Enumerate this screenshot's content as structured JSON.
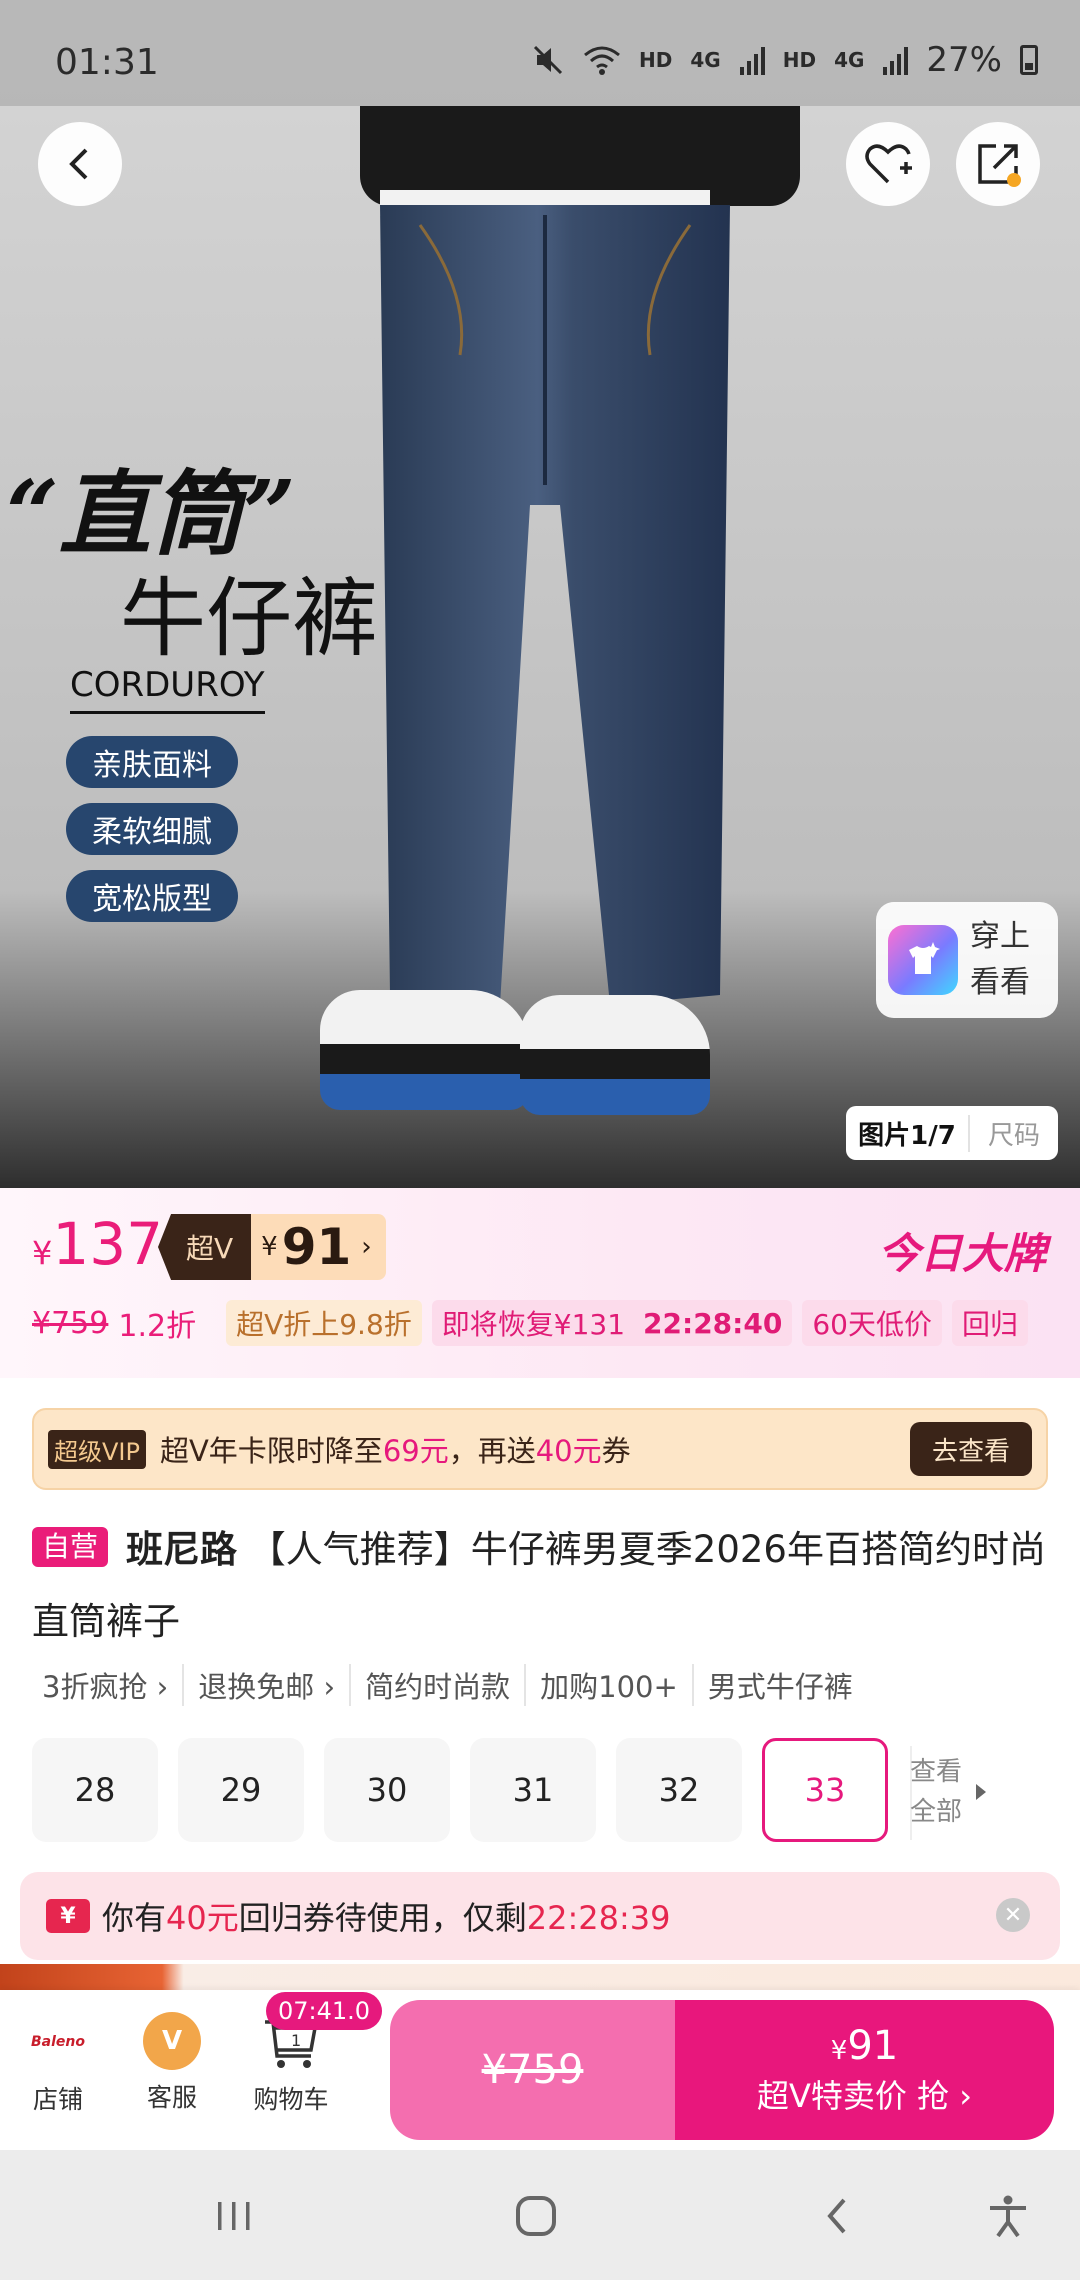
{
  "status_bar": {
    "time": "01:31",
    "hd1": "HD",
    "net1": "4G",
    "hd2": "HD",
    "net2": "4G",
    "battery": "27%"
  },
  "hero": {
    "promo_title": "“直筒”",
    "promo_subtitle": "牛仔裤",
    "promo_english": "CORDUROY",
    "promo_pills": [
      "亲肤面料",
      "柔软细腻",
      "宽松版型"
    ],
    "try_on_line1": "穿上",
    "try_on_line2": "看看",
    "image_tab_current": "图片1/7",
    "image_tab_size": "尺码"
  },
  "price": {
    "currency": "¥",
    "current": "137",
    "superv_label": "超V",
    "superv_price": "91",
    "today_brand": "今日大牌",
    "original": "¥759",
    "discount": "1.2折",
    "chips": {
      "superv_discount": "超V折上9.8折",
      "restore": "即将恢复¥131",
      "restore_countdown": "22:28:40",
      "low_price": "60天低价",
      "return": "回归"
    }
  },
  "vip_banner": {
    "badge": "超级VIP",
    "text_prefix": "超V年卡限时降至",
    "price": "69元",
    "text_middle": "，再送",
    "coupon": "40元",
    "text_suffix": "券",
    "button": "去查看"
  },
  "product": {
    "self_tag": "自营",
    "brand": "班尼路",
    "title": "【人气推荐】牛仔裤男夏季2026年百搭简约时尚直筒裤子"
  },
  "features": [
    "3折疯抢 ›",
    "退换免邮 ›",
    "简约时尚款",
    "加购100+",
    "男式牛仔裤"
  ],
  "sizes": {
    "options": [
      "28",
      "29",
      "30",
      "31",
      "32",
      "33"
    ],
    "selected": "33",
    "more_line1": "查看",
    "more_line2": "全部"
  },
  "coupon_notice": {
    "icon_text": "¥",
    "text_prefix": "你有",
    "amount": "40元",
    "text_middle": "回归券待使用，仅剩",
    "countdown": "22:28:39"
  },
  "bottom_bar": {
    "shop_logo": "Baleno",
    "shop_label": "店铺",
    "service_label": "客服",
    "cart_label": "购物车",
    "cart_count": "1",
    "timer": "07:41.0",
    "buy_original": "¥759",
    "buy_currency": "¥",
    "buy_price": "91",
    "buy_label": "超V特卖价 抢 ›"
  },
  "colors": {
    "accent_pink": "#e8177c",
    "gold_dark": "#3a2418",
    "gold_light": "#fddcb8",
    "pill_navy": "#27466e"
  }
}
